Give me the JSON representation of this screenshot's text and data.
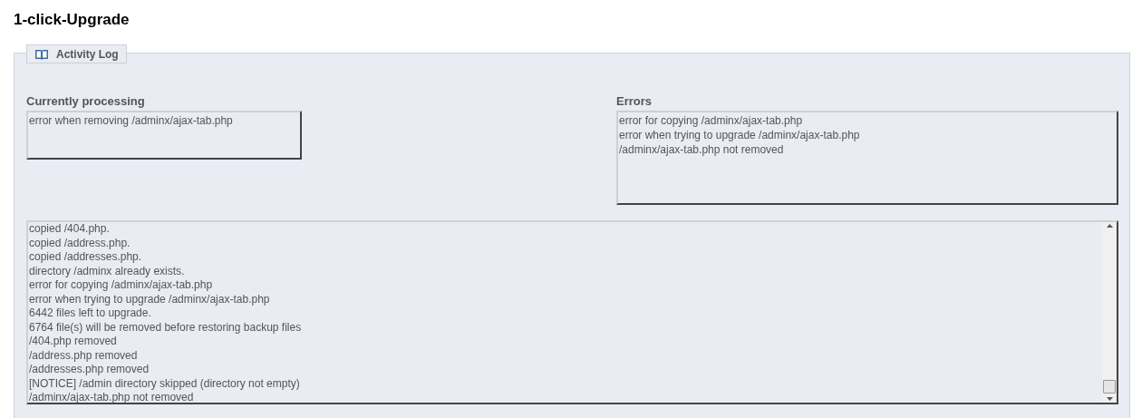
{
  "page_title": "1-click-Upgrade",
  "panel": {
    "legend": "Activity Log",
    "currently_processing": {
      "label": "Currently processing",
      "lines": [
        "error when removing /adminx/ajax-tab.php"
      ]
    },
    "errors": {
      "label": "Errors",
      "lines": [
        "error for copying /adminx/ajax-tab.php",
        "error when trying to upgrade /adminx/ajax-tab.php",
        "/adminx/ajax-tab.php not removed"
      ]
    },
    "log": {
      "lines": [
        "copied /404.php.",
        "copied /address.php.",
        "copied /addresses.php.",
        "directory /adminx already exists.",
        "error for copying /adminx/ajax-tab.php",
        "error when trying to upgrade /adminx/ajax-tab.php",
        "6442 files left to upgrade.",
        "6764 file(s) will be removed before restoring backup files",
        "/404.php removed",
        "/address.php removed",
        "/addresses.php removed",
        "[NOTICE] /admin directory skipped (directory not empty)",
        "/adminx/ajax-tab.php not removed"
      ]
    }
  }
}
